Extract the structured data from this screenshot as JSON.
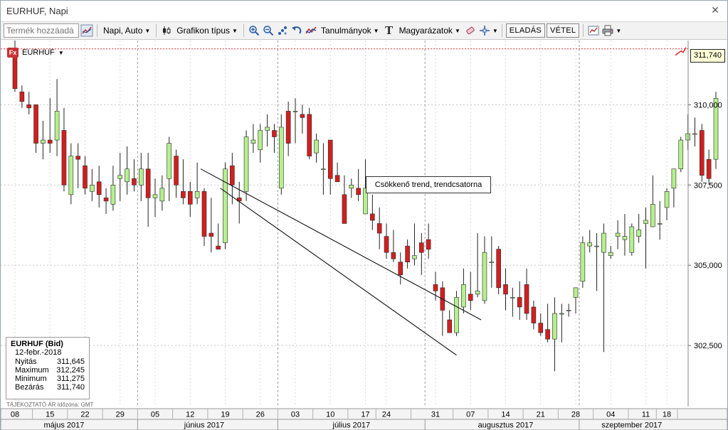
{
  "window": {
    "title": "EURHUF, Napi"
  },
  "toolbar": {
    "product_placeholder": "Termék hozzáadá",
    "period_label": "Napi, Auto",
    "chart_type_label": "Grafikon típus",
    "studies_label": "Tanulmányok",
    "annotations_label": "Magyarázatok",
    "sell_label": "ELADÁS",
    "buy_label": "VÉTEL"
  },
  "instrument": {
    "badge": "Fx",
    "symbol": "EURHUF"
  },
  "info_box": {
    "title": "EURHUF (Bid)",
    "date": "12-febr.-2018",
    "rows": [
      {
        "label": "Nyitás",
        "value": "311,645"
      },
      {
        "label": "Maximum",
        "value": "312,245"
      },
      {
        "label": "Minimum",
        "value": "311,275"
      },
      {
        "label": "Bezárás",
        "value": "311,740"
      }
    ]
  },
  "footnote": "TÁJÉKOZTATÓ ÁR   Időzóna: GMT",
  "colors": {
    "up": "#b5ef8e",
    "down": "#d21f1f",
    "wick": "#222222",
    "grid": "#c8c8c8",
    "last_line": "#e03030"
  },
  "chart_data": {
    "type": "candlestick",
    "symbol": "EURHUF",
    "y_axis": {
      "side": "right",
      "ticks": [
        302.5,
        305.0,
        307.5,
        310.0
      ],
      "tick_labels": [
        "302,500",
        "305,000",
        "307,500",
        "310,000"
      ],
      "range": [
        300.6,
        312.0
      ]
    },
    "last_price": 311.74,
    "last_price_label": "311,740",
    "x_ticks": [
      {
        "label": "08",
        "index": 0
      },
      {
        "label": "15",
        "index": 5
      },
      {
        "label": "22",
        "index": 10
      },
      {
        "label": "29",
        "index": 15
      },
      {
        "label": "05",
        "index": 20
      },
      {
        "label": "12",
        "index": 25
      },
      {
        "label": "19",
        "index": 30
      },
      {
        "label": "26",
        "index": 35
      },
      {
        "label": "03",
        "index": 40
      },
      {
        "label": "10",
        "index": 45
      },
      {
        "label": "17",
        "index": 50
      },
      {
        "label": "24",
        "index": 53
      },
      {
        "label": "31",
        "index": 60
      },
      {
        "label": "07",
        "index": 65
      },
      {
        "label": "14",
        "index": 70
      },
      {
        "label": "21",
        "index": 75
      },
      {
        "label": "28",
        "index": 80
      },
      {
        "label": "04",
        "index": 85
      },
      {
        "label": "11",
        "index": 90
      },
      {
        "label": "18",
        "index": 93
      }
    ],
    "month_labels": [
      {
        "label": "május 2017",
        "center_index": 7
      },
      {
        "label": "június 2017",
        "center_index": 27
      },
      {
        "label": "július 2017",
        "center_index": 48
      },
      {
        "label": "augusztus 2017",
        "center_index": 70
      },
      {
        "label": "szeptember 2017",
        "center_index": 88
      }
    ],
    "month_boundaries": [
      18,
      38,
      59,
      81
    ],
    "candles": [
      {
        "o": 311.7,
        "h": 312.0,
        "l": 310.4,
        "c": 310.5
      },
      {
        "o": 310.4,
        "h": 310.6,
        "l": 309.9,
        "c": 310.1
      },
      {
        "o": 310.0,
        "h": 310.4,
        "l": 309.7,
        "c": 309.9
      },
      {
        "o": 310.0,
        "h": 310.0,
        "l": 308.5,
        "c": 308.8
      },
      {
        "o": 308.8,
        "h": 309.5,
        "l": 308.3,
        "c": 308.9
      },
      {
        "o": 308.9,
        "h": 310.2,
        "l": 308.5,
        "c": 308.8
      },
      {
        "o": 308.9,
        "h": 310.8,
        "l": 308.4,
        "c": 309.8
      },
      {
        "o": 309.2,
        "h": 309.9,
        "l": 307.3,
        "c": 307.5
      },
      {
        "o": 307.2,
        "h": 308.8,
        "l": 306.9,
        "c": 308.4
      },
      {
        "o": 308.4,
        "h": 308.8,
        "l": 307.4,
        "c": 308.3
      },
      {
        "o": 308.1,
        "h": 308.4,
        "l": 307.2,
        "c": 307.4
      },
      {
        "o": 307.3,
        "h": 308.0,
        "l": 307.0,
        "c": 307.5
      },
      {
        "o": 307.6,
        "h": 308.1,
        "l": 306.8,
        "c": 307.2
      },
      {
        "o": 307.1,
        "h": 307.4,
        "l": 306.6,
        "c": 307.0
      },
      {
        "o": 306.9,
        "h": 308.1,
        "l": 306.7,
        "c": 307.5
      },
      {
        "o": 307.7,
        "h": 308.5,
        "l": 307.0,
        "c": 307.8
      },
      {
        "o": 307.6,
        "h": 308.7,
        "l": 307.2,
        "c": 308.0
      },
      {
        "o": 307.7,
        "h": 308.3,
        "l": 307.3,
        "c": 307.5
      },
      {
        "o": 307.5,
        "h": 308.5,
        "l": 307.0,
        "c": 308.0
      },
      {
        "o": 308.0,
        "h": 308.5,
        "l": 306.2,
        "c": 307.1
      },
      {
        "o": 307.1,
        "h": 307.7,
        "l": 306.5,
        "c": 307.2
      },
      {
        "o": 307.0,
        "h": 307.8,
        "l": 306.7,
        "c": 307.4
      },
      {
        "o": 307.7,
        "h": 309.0,
        "l": 307.0,
        "c": 308.8
      },
      {
        "o": 308.4,
        "h": 308.6,
        "l": 307.1,
        "c": 307.5
      },
      {
        "o": 307.3,
        "h": 308.3,
        "l": 306.9,
        "c": 307.1
      },
      {
        "o": 307.3,
        "h": 307.6,
        "l": 306.5,
        "c": 306.9
      },
      {
        "o": 307.1,
        "h": 308.2,
        "l": 306.9,
        "c": 307.3
      },
      {
        "o": 307.3,
        "h": 307.4,
        "l": 305.6,
        "c": 305.9
      },
      {
        "o": 306.0,
        "h": 307.1,
        "l": 305.4,
        "c": 305.9
      },
      {
        "o": 305.6,
        "h": 306.3,
        "l": 305.5,
        "c": 305.5
      },
      {
        "o": 305.7,
        "h": 308.2,
        "l": 305.5,
        "c": 308.0
      },
      {
        "o": 308.1,
        "h": 308.5,
        "l": 306.9,
        "c": 307.5
      },
      {
        "o": 307.1,
        "h": 307.6,
        "l": 306.3,
        "c": 307.0
      },
      {
        "o": 307.3,
        "h": 309.2,
        "l": 307.0,
        "c": 309.0
      },
      {
        "o": 308.8,
        "h": 309.4,
        "l": 308.5,
        "c": 308.9
      },
      {
        "o": 308.6,
        "h": 309.4,
        "l": 308.2,
        "c": 309.2
      },
      {
        "o": 309.2,
        "h": 309.7,
        "l": 308.7,
        "c": 309.3
      },
      {
        "o": 309.2,
        "h": 309.4,
        "l": 308.5,
        "c": 309.0
      },
      {
        "o": 307.4,
        "h": 309.7,
        "l": 307.2,
        "c": 309.3
      },
      {
        "o": 309.8,
        "h": 310.1,
        "l": 308.4,
        "c": 308.8
      },
      {
        "o": 309.8,
        "h": 310.2,
        "l": 308.8,
        "c": 309.8
      },
      {
        "o": 309.7,
        "h": 310.0,
        "l": 309.1,
        "c": 309.6
      },
      {
        "o": 309.7,
        "h": 309.9,
        "l": 308.3,
        "c": 308.4
      },
      {
        "o": 308.5,
        "h": 309.1,
        "l": 308.2,
        "c": 308.9
      },
      {
        "o": 308.0,
        "h": 308.8,
        "l": 307.2,
        "c": 308.0
      },
      {
        "o": 308.9,
        "h": 308.9,
        "l": 307.2,
        "c": 307.7
      },
      {
        "o": 307.8,
        "h": 308.2,
        "l": 307.6,
        "c": 307.6
      },
      {
        "o": 307.2,
        "h": 307.8,
        "l": 306.3,
        "c": 306.3
      },
      {
        "o": 307.4,
        "h": 307.7,
        "l": 307.1,
        "c": 307.5
      },
      {
        "o": 307.4,
        "h": 308.0,
        "l": 307.0,
        "c": 307.2
      },
      {
        "o": 306.6,
        "h": 308.3,
        "l": 306.6,
        "c": 307.4
      },
      {
        "o": 306.6,
        "h": 307.2,
        "l": 306.1,
        "c": 306.4
      },
      {
        "o": 306.3,
        "h": 306.8,
        "l": 305.5,
        "c": 306.0
      },
      {
        "o": 305.9,
        "h": 306.3,
        "l": 305.2,
        "c": 305.4
      },
      {
        "o": 305.4,
        "h": 306.1,
        "l": 305.1,
        "c": 305.2
      },
      {
        "o": 305.1,
        "h": 305.4,
        "l": 304.4,
        "c": 304.7
      },
      {
        "o": 305.6,
        "h": 305.8,
        "l": 304.9,
        "c": 305.1
      },
      {
        "o": 305.2,
        "h": 306.3,
        "l": 305.0,
        "c": 305.3
      },
      {
        "o": 305.7,
        "h": 306.0,
        "l": 304.7,
        "c": 305.4
      },
      {
        "o": 305.8,
        "h": 306.3,
        "l": 305.2,
        "c": 305.5
      },
      {
        "o": 304.4,
        "h": 304.8,
        "l": 303.9,
        "c": 304.2
      },
      {
        "o": 304.3,
        "h": 304.5,
        "l": 302.8,
        "c": 303.6
      },
      {
        "o": 303.3,
        "h": 303.6,
        "l": 302.9,
        "c": 302.9
      },
      {
        "o": 302.9,
        "h": 304.2,
        "l": 302.8,
        "c": 304.0
      },
      {
        "o": 303.7,
        "h": 304.9,
        "l": 303.5,
        "c": 304.4
      },
      {
        "o": 304.1,
        "h": 304.8,
        "l": 303.6,
        "c": 303.9
      },
      {
        "o": 304.1,
        "h": 306.0,
        "l": 304.0,
        "c": 304.2
      },
      {
        "o": 303.9,
        "h": 305.9,
        "l": 303.8,
        "c": 305.4
      },
      {
        "o": 305.1,
        "h": 305.9,
        "l": 304.3,
        "c": 305.1
      },
      {
        "o": 305.5,
        "h": 305.6,
        "l": 304.1,
        "c": 304.3
      },
      {
        "o": 304.4,
        "h": 304.9,
        "l": 303.6,
        "c": 304.1
      },
      {
        "o": 304.0,
        "h": 304.3,
        "l": 303.4,
        "c": 304.0
      },
      {
        "o": 304.0,
        "h": 304.5,
        "l": 303.3,
        "c": 303.7
      },
      {
        "o": 304.4,
        "h": 304.9,
        "l": 303.3,
        "c": 303.5
      },
      {
        "o": 303.7,
        "h": 303.9,
        "l": 303.0,
        "c": 303.2
      },
      {
        "o": 303.2,
        "h": 303.5,
        "l": 302.8,
        "c": 302.9
      },
      {
        "o": 303.0,
        "h": 303.8,
        "l": 302.6,
        "c": 302.7
      },
      {
        "o": 302.7,
        "h": 304.0,
        "l": 301.7,
        "c": 303.5
      },
      {
        "o": 303.5,
        "h": 303.8,
        "l": 302.6,
        "c": 303.5
      },
      {
        "o": 303.6,
        "h": 303.8,
        "l": 303.4,
        "c": 303.6
      },
      {
        "o": 304.0,
        "h": 304.3,
        "l": 303.5,
        "c": 304.3
      },
      {
        "o": 304.5,
        "h": 305.9,
        "l": 304.3,
        "c": 305.7
      },
      {
        "o": 305.6,
        "h": 306.1,
        "l": 305.4,
        "c": 305.7
      },
      {
        "o": 305.6,
        "h": 306.0,
        "l": 304.2,
        "c": 305.6
      },
      {
        "o": 305.4,
        "h": 306.3,
        "l": 302.3,
        "c": 306.0
      },
      {
        "o": 305.3,
        "h": 305.6,
        "l": 305.2,
        "c": 305.4
      },
      {
        "o": 305.9,
        "h": 306.4,
        "l": 305.5,
        "c": 306.0
      },
      {
        "o": 305.8,
        "h": 306.6,
        "l": 305.3,
        "c": 305.9
      },
      {
        "o": 305.4,
        "h": 306.3,
        "l": 305.3,
        "c": 306.2
      },
      {
        "o": 305.9,
        "h": 306.6,
        "l": 305.7,
        "c": 306.1
      },
      {
        "o": 306.3,
        "h": 306.8,
        "l": 304.9,
        "c": 306.4
      },
      {
        "o": 306.2,
        "h": 307.8,
        "l": 306.2,
        "c": 306.9
      },
      {
        "o": 306.3,
        "h": 307.0,
        "l": 305.8,
        "c": 306.3
      },
      {
        "o": 306.8,
        "h": 307.4,
        "l": 306.4,
        "c": 307.3
      },
      {
        "o": 307.4,
        "h": 308.0,
        "l": 306.8,
        "c": 308.0
      },
      {
        "o": 308.0,
        "h": 309.0,
        "l": 307.9,
        "c": 308.9
      },
      {
        "o": 308.9,
        "h": 309.7,
        "l": 308.6,
        "c": 309.1
      },
      {
        "o": 309.1,
        "h": 309.6,
        "l": 308.7,
        "c": 309.1
      },
      {
        "o": 309.2,
        "h": 309.4,
        "l": 307.6,
        "c": 307.8
      },
      {
        "o": 308.3,
        "h": 308.6,
        "l": 307.5,
        "c": 307.7
      },
      {
        "o": 308.3,
        "h": 310.4,
        "l": 308.0,
        "c": 310.2
      }
    ],
    "trend_lines": [
      {
        "from": {
          "index": 26.5,
          "value": 308.0
        },
        "to": {
          "index": 66.5,
          "value": 303.3
        }
      },
      {
        "from": {
          "index": 29.3,
          "value": 307.4
        },
        "to": {
          "index": 63.0,
          "value": 302.2
        }
      }
    ],
    "annotation": {
      "text": "Csökkenő trend, trendcsatorna"
    }
  }
}
